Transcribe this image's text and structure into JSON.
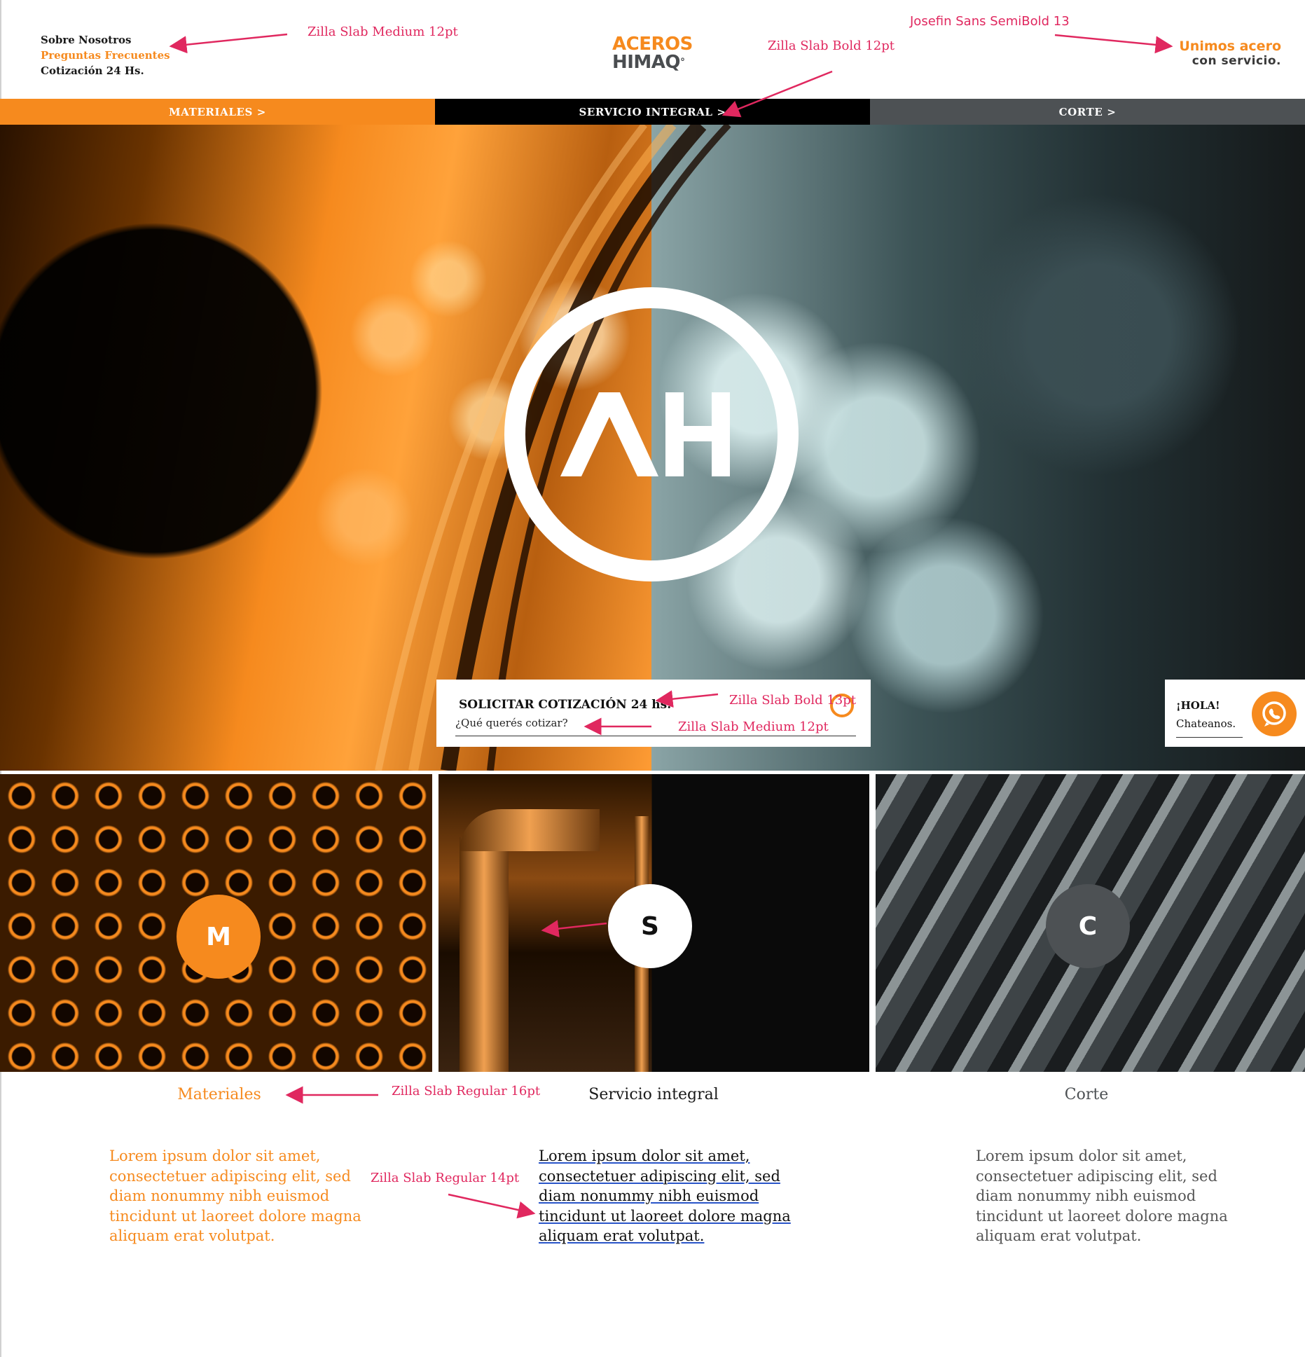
{
  "header": {
    "links": [
      "Sobre Nosotros",
      "Preguntas Frecuentes",
      "Cotización 24 Hs."
    ],
    "logo": {
      "line1": "ACEROS",
      "line2": "HIMAQ",
      "mark": "°"
    },
    "tagline": {
      "line1": "Unimos acero",
      "line2": "con servicio."
    }
  },
  "nav": {
    "items": [
      "MATERIALES >",
      "SERVICIO INTEGRAL >",
      "CORTE >"
    ]
  },
  "hero": {
    "emblem_text": "AH",
    "quote": {
      "title": "SOLICITAR COTIZACIÓN 24 hs.",
      "placeholder": "¿Qué querés cotizar?"
    },
    "chat": {
      "greeting": "¡HOLA!",
      "cta": "Chateanos.",
      "icon": "whatsapp-icon"
    }
  },
  "tiles": [
    {
      "badge": "M",
      "title": "Materiales",
      "text": "Lorem ipsum dolor sit amet, consectetuer adipiscing elit, sed diam nonummy nibh euismod tincidunt ut laoreet dolore magna aliquam erat volutpat."
    },
    {
      "badge": "S",
      "title": "Servicio integral",
      "text": "Lorem ipsum dolor sit amet, consectetuer adipiscing elit, sed diam nonummy nibh euismod tincidunt ut laoreet dolore magna aliquam erat volutpat."
    },
    {
      "badge": "C",
      "title": "Corte",
      "text": "Lorem ipsum dolor sit amet, consectetuer adipiscing elit, sed diam nonummy nibh euismod tincidunt ut laoreet dolore magna aliquam erat volutpat."
    }
  ],
  "annotations": {
    "links_font": "Zilla Slab Medium 12pt",
    "tagline_font": "Josefin Sans SemiBold 13",
    "nav_font": "Zilla Slab Bold 12pt",
    "quote_title_font": "Zilla Slab Bold 13pt",
    "quote_sub_font": "Zilla Slab Medium 12pt",
    "titles_font": "Zilla Slab Regular  16pt",
    "body_font": "Zilla Slab Regular  14pt"
  },
  "colors": {
    "orange": "#f68a1e",
    "black": "#000000",
    "gray": "#4d5154",
    "annotation": "#e0285f"
  }
}
